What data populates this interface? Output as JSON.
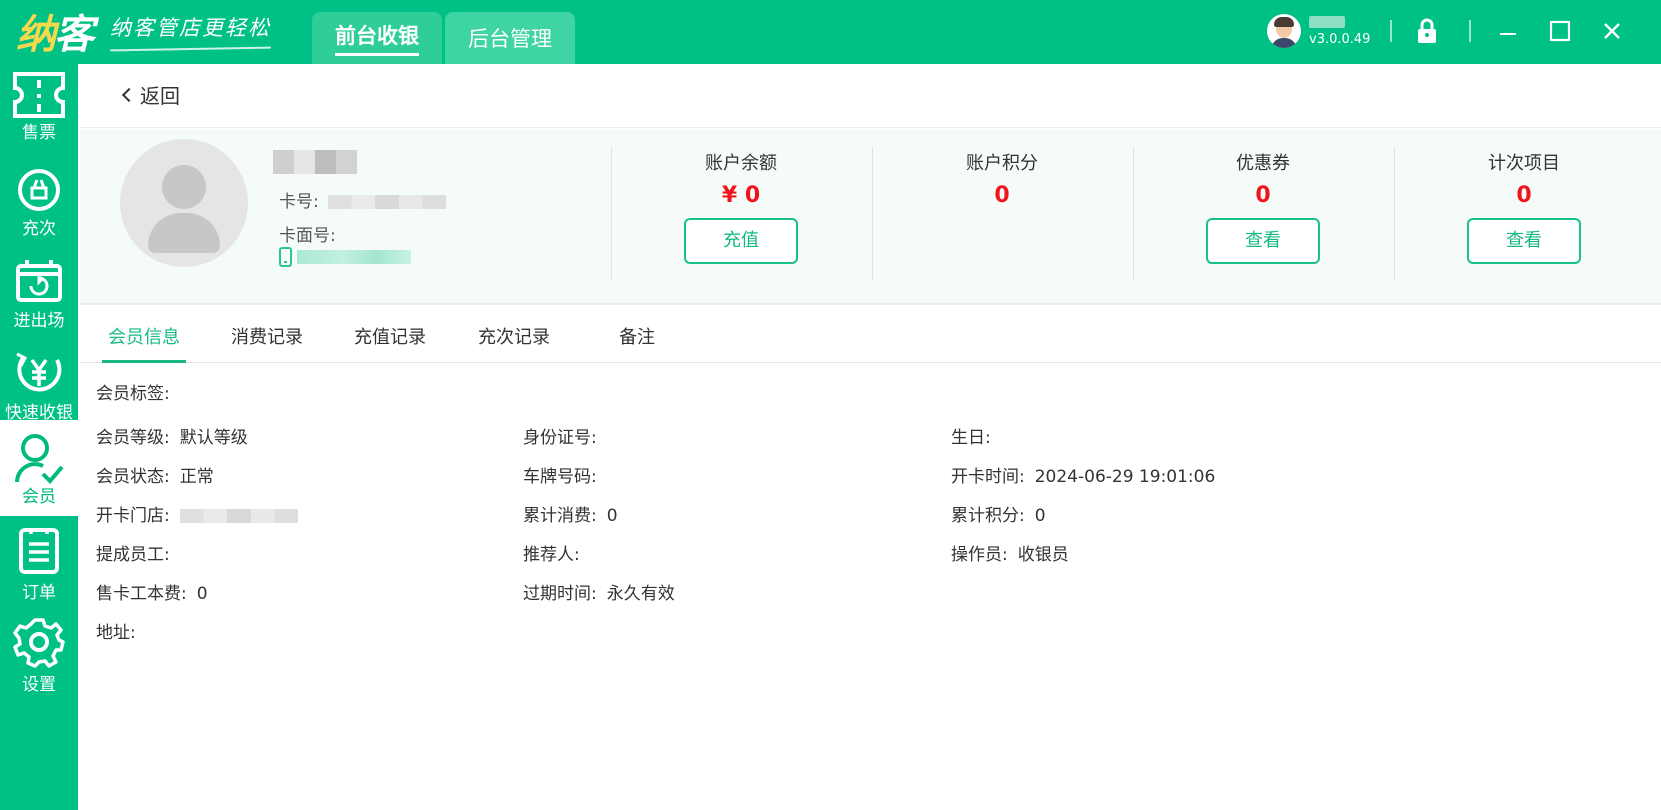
{
  "header": {
    "logo_text": "纳客",
    "slogan": "纳客管店更轻松",
    "tabs": [
      {
        "label": "前台收银",
        "active": true
      },
      {
        "label": "后台管理",
        "active": false
      }
    ],
    "version": "v3.0.0.49",
    "icons": [
      "lock-icon",
      "minimize-icon",
      "maximize-icon",
      "close-icon"
    ]
  },
  "sidebar": {
    "items": [
      {
        "label": "售票",
        "icon": "ticket-icon"
      },
      {
        "label": "充次",
        "icon": "recharge-count-icon"
      },
      {
        "label": "进出场",
        "icon": "entry-exit-icon"
      },
      {
        "label": "快速收银",
        "icon": "quick-cashier-icon"
      },
      {
        "label": "会员",
        "icon": "member-icon",
        "active": true
      },
      {
        "label": "订单",
        "icon": "order-icon"
      },
      {
        "label": "设置",
        "icon": "settings-icon"
      }
    ]
  },
  "back": {
    "label": "返回"
  },
  "profile": {
    "card_no_label": "卡号:",
    "card_face_no_label": "卡面号:",
    "stats": [
      {
        "title": "账户余额",
        "value": "¥ 0",
        "button": "充值"
      },
      {
        "title": "账户积分",
        "value": "0",
        "button": ""
      },
      {
        "title": "优惠券",
        "value": "0",
        "button": "查看"
      },
      {
        "title": "计次项目",
        "value": "0",
        "button": "查看"
      }
    ]
  },
  "tabs": [
    {
      "label": "会员信息",
      "active": true
    },
    {
      "label": "消费记录"
    },
    {
      "label": "充值记录"
    },
    {
      "label": "充次记录"
    },
    {
      "label": "备注"
    }
  ],
  "member_info": {
    "tags_label": "会员标签:",
    "level_label": "会员等级:",
    "level_value": "默认等级",
    "id_label": "身份证号:",
    "id_value": "",
    "birthday_label": "生日:",
    "birthday_value": "",
    "status_label": "会员状态:",
    "status_value": "正常",
    "plate_label": "车牌号码:",
    "plate_value": "",
    "open_time_label": "开卡时间:",
    "open_time_value": "2024-06-29 19:01:06",
    "store_label": "开卡门店:",
    "total_spend_label": "累计消费:",
    "total_spend_value": "0",
    "total_points_label": "累计积分:",
    "total_points_value": "0",
    "commission_staff_label": "提成员工:",
    "commission_staff_value": "",
    "referrer_label": "推荐人:",
    "referrer_value": "",
    "operator_label": "操作员:",
    "operator_value": "收银员",
    "card_fee_label": "售卡工本费:",
    "card_fee_value": "0",
    "expire_label": "过期时间:",
    "expire_value": "永久有效",
    "address_label": "地址:",
    "address_value": ""
  }
}
